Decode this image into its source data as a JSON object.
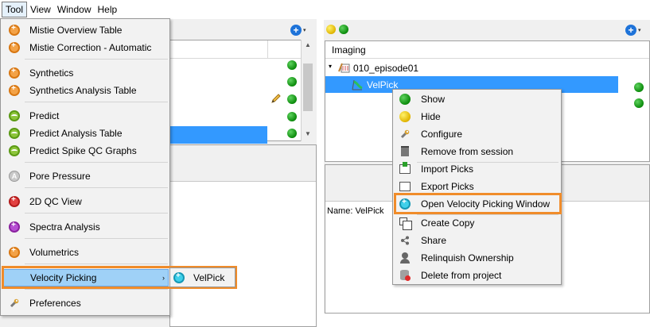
{
  "menubar": {
    "items": [
      "Tool",
      "View",
      "Window",
      "Help"
    ]
  },
  "tool_menu": {
    "items": [
      {
        "label": "Mistie Overview Table",
        "icon": "mistie-icon"
      },
      {
        "label": "Mistie Correction - Automatic",
        "icon": "mistie-icon"
      },
      {
        "label": "Synthetics",
        "icon": "synthetics-icon"
      },
      {
        "label": "Synthetics Analysis Table",
        "icon": "synthetics-icon"
      },
      {
        "label": "Predict",
        "icon": "predict-icon"
      },
      {
        "label": "Predict Analysis Table",
        "icon": "predict-icon"
      },
      {
        "label": "Predict Spike QC Graphs",
        "icon": "predict-icon"
      },
      {
        "label": "Pore Pressure",
        "icon": "pore-pressure-icon"
      },
      {
        "label": "2D QC View",
        "icon": "qc-view-icon"
      },
      {
        "label": "Spectra Analysis",
        "icon": "spectra-icon"
      },
      {
        "label": "Volumetrics",
        "icon": "volumetrics-icon"
      },
      {
        "label": "Velocity Picking",
        "icon": "velocity-picking-icon"
      },
      {
        "label": "Preferences",
        "icon": "wrench-icon"
      }
    ],
    "submenu_arrow": "›",
    "submenu": {
      "label": "VelPick",
      "icon": "velpick-icon"
    }
  },
  "right_panel": {
    "tree_header": "Imaging",
    "tree_rows": [
      {
        "label": "010_episode01",
        "icon": "episode-folder-icon"
      },
      {
        "label": "VelPick",
        "icon": "velpick-item-icon"
      }
    ],
    "name_label": "Name: VelPick"
  },
  "context_menu": {
    "items": [
      {
        "label": "Show",
        "icon": "green-dot-icon"
      },
      {
        "label": "Hide",
        "icon": "yellow-dot-icon"
      },
      {
        "label": "Configure",
        "icon": "wrench-icon"
      },
      {
        "label": "Remove from session",
        "icon": "trash-icon"
      },
      {
        "label": "Import Picks",
        "icon": "import-icon"
      },
      {
        "label": "Export Picks",
        "icon": "export-icon"
      },
      {
        "label": "Open Velocity Picking Window",
        "icon": "velocity-window-icon"
      },
      {
        "label": "Create Copy",
        "icon": "copy-icon"
      },
      {
        "label": "Share",
        "icon": "share-icon"
      },
      {
        "label": "Relinquish Ownership",
        "icon": "person-icon"
      },
      {
        "label": "Delete from project",
        "icon": "delete-db-icon"
      }
    ]
  },
  "colors": {
    "highlight_outline": "#f08c2a",
    "selection_blue": "#3399ff",
    "menu_hover": "#9fd1f7",
    "status_green": "#0a8a0a"
  },
  "glyphs": {
    "plus": "+",
    "caret": "▾",
    "tree_expand": "▾",
    "scroll_up": "▲",
    "scroll_down": "▼"
  }
}
